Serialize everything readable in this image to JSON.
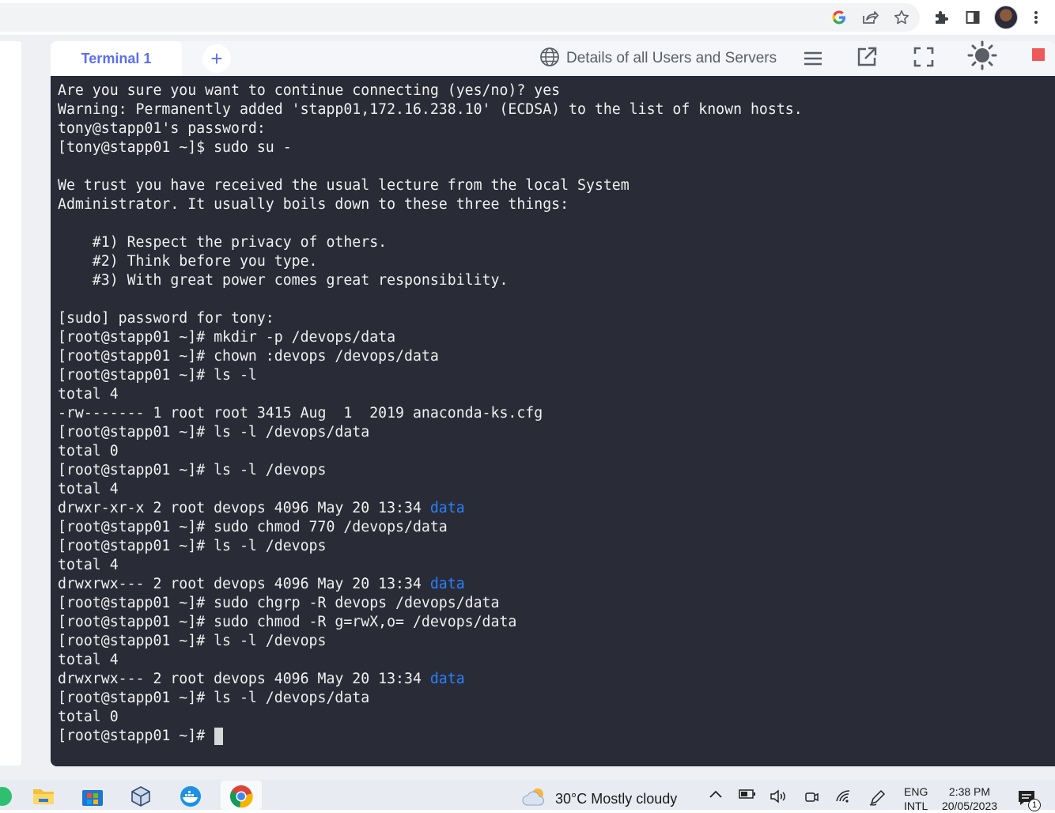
{
  "browser": {
    "icons": [
      "google-icon",
      "share-icon",
      "star-icon",
      "extensions-icon",
      "side-panel-icon",
      "avatar",
      "kebab-menu-icon"
    ]
  },
  "terminal_header": {
    "active_tab_label": "Terminal 1",
    "add_tab_label": "+",
    "details_label": "Details of all Users and Servers",
    "accent_color": "#5b6ef5"
  },
  "terminal": {
    "background": "#292c36",
    "dir_color": "#2a7fff",
    "lines": [
      "Are you sure you want to continue connecting (yes/no)? yes",
      "Warning: Permanently added 'stapp01,172.16.238.10' (ECDSA) to the list of known hosts.",
      "tony@stapp01's password:",
      "[tony@stapp01 ~]$ sudo su -",
      "",
      "We trust you have received the usual lecture from the local System",
      "Administrator. It usually boils down to these three things:",
      "",
      "    #1) Respect the privacy of others.",
      "    #2) Think before you type.",
      "    #3) With great power comes great responsibility.",
      "",
      "[sudo] password for tony:",
      "[root@stapp01 ~]# mkdir -p /devops/data",
      "[root@stapp01 ~]# chown :devops /devops/data",
      "[root@stapp01 ~]# ls -l",
      "total 4",
      "-rw------- 1 root root 3415 Aug  1  2019 anaconda-ks.cfg",
      "[root@stapp01 ~]# ls -l /devops/data",
      "total 0",
      "[root@stapp01 ~]# ls -l /devops",
      "total 4",
      "drwxr-xr-x 2 root devops 4096 May 20 13:34 ",
      "[root@stapp01 ~]# sudo chmod 770 /devops/data",
      "[root@stapp01 ~]# ls -l /devops",
      "total 4",
      "drwxrwx--- 2 root devops 4096 May 20 13:34 ",
      "[root@stapp01 ~]# sudo chgrp -R devops /devops/data",
      "[root@stapp01 ~]# sudo chmod -R g=rwX,o= /devops/data",
      "[root@stapp01 ~]# ls -l /devops",
      "total 4",
      "drwxrwx--- 2 root devops 4096 May 20 13:34 ",
      "[root@stapp01 ~]# ls -l /devops/data",
      "total 0",
      "[root@stapp01 ~]# "
    ],
    "dir_name": "data"
  },
  "taskbar": {
    "weather_text": "30°C  Mostly cloudy",
    "lang_line1": "ENG",
    "lang_line2": "INTL",
    "time": "2:38 PM",
    "date": "20/05/2023",
    "notification_count": "1"
  }
}
